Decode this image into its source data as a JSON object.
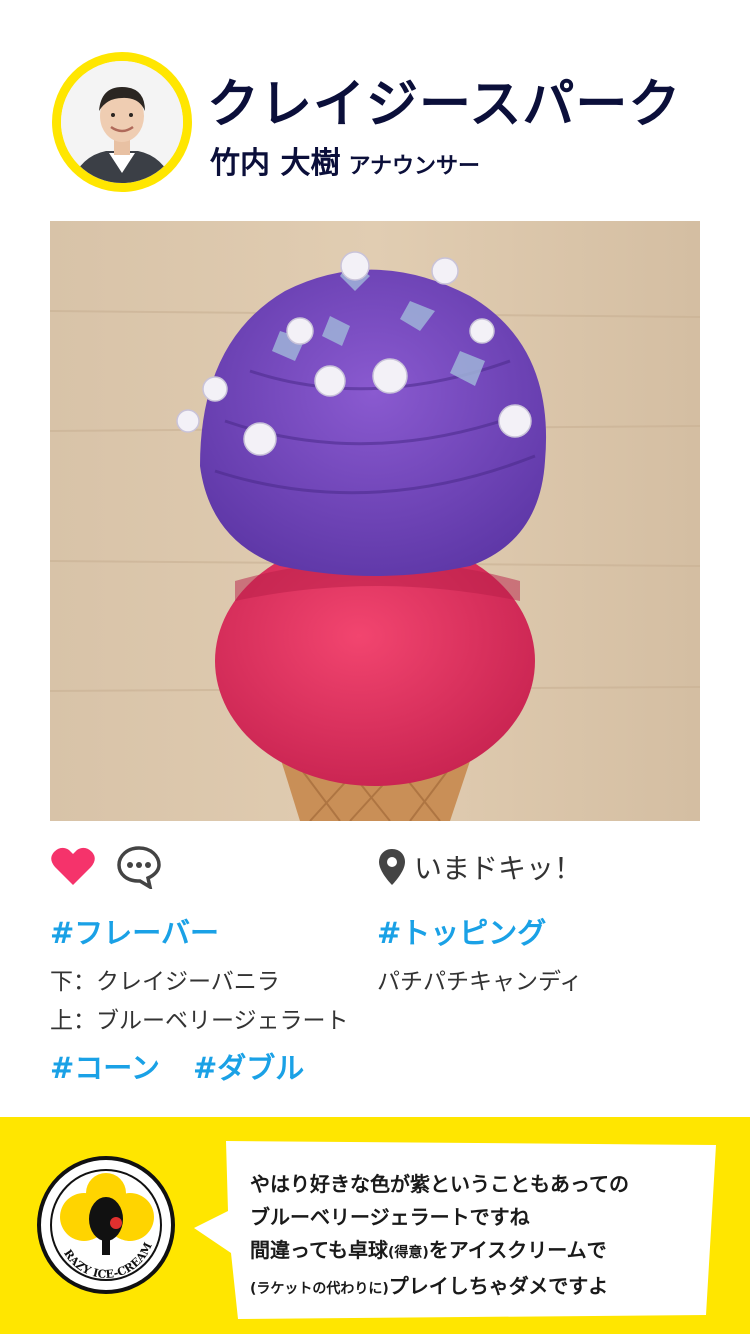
{
  "header": {
    "shop_name": "クレイジースパーク",
    "person_name": "竹内 大樹",
    "role": "アナウンサー"
  },
  "actions": {
    "like_icon": "heart-icon",
    "comment_icon": "speech-bubble-icon",
    "location_icon": "map-pin-icon",
    "location_label": "いまドキッ！",
    "like_color": "#f5336b"
  },
  "flavor": {
    "tag": "#フレーバー",
    "lines": [
      "下：クレイジーバニラ",
      "上：ブルーベリージェラート"
    ]
  },
  "topping": {
    "tag": "#トッピング",
    "value": "パチパチキャンディ"
  },
  "extra_tags": [
    "#コーン",
    "#ダブル"
  ],
  "comment": {
    "lines": [
      "やはり好きな色が紫ということもあっての",
      "ブルーベリージェラートですね"
    ],
    "line3_a": "間違っても卓球",
    "line3_small": "(得意)",
    "line3_b": "をアイスクリームで",
    "line4_small": "(ラケットの代わりに)",
    "line4_b": "プレイしちゃダメですよ"
  },
  "logo": {
    "text": "CRAZY ICE-CREAM"
  },
  "colors": {
    "accent_yellow": "#ffe600",
    "tag_blue": "#1aa1e6",
    "title_navy": "#0b0f3a"
  }
}
